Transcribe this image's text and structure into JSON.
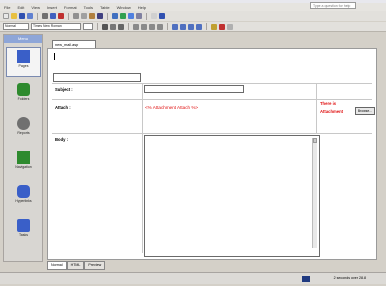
{
  "menu": [
    "File",
    "Edit",
    "View",
    "Insert",
    "Format",
    "Tools",
    "Table",
    "Window",
    "Help"
  ],
  "help_placeholder": "Type a question for help",
  "toolbar": {
    "style_value": "Normal",
    "font_value": "Times New Roman"
  },
  "sidebar": {
    "header": "Menu",
    "items": [
      {
        "label": "Pages",
        "color": "#3a5fc8"
      },
      {
        "label": "Folders",
        "color": "#2e8a2e"
      },
      {
        "label": "Reports",
        "color": "#707070"
      },
      {
        "label": "Navigation",
        "color": "#2e8a2e"
      },
      {
        "label": "Hyperlinks",
        "color": "#3a5fc8"
      },
      {
        "label": "Tasks",
        "color": "#3a5fc8"
      }
    ]
  },
  "document": {
    "tab": "new_mail.asp",
    "subject_label": "Subject :",
    "attach_label": "Attach :",
    "attach_value": "<% Attachment Attach %>",
    "attach_note_1": "There is",
    "attach_note_2": "Attachment",
    "browse_label": "Browse...",
    "body_label": "Body :"
  },
  "bottom_tabs": [
    "Normal",
    "HTML",
    "Preview"
  ],
  "status": {
    "text": "2 seconds over 28.8"
  }
}
